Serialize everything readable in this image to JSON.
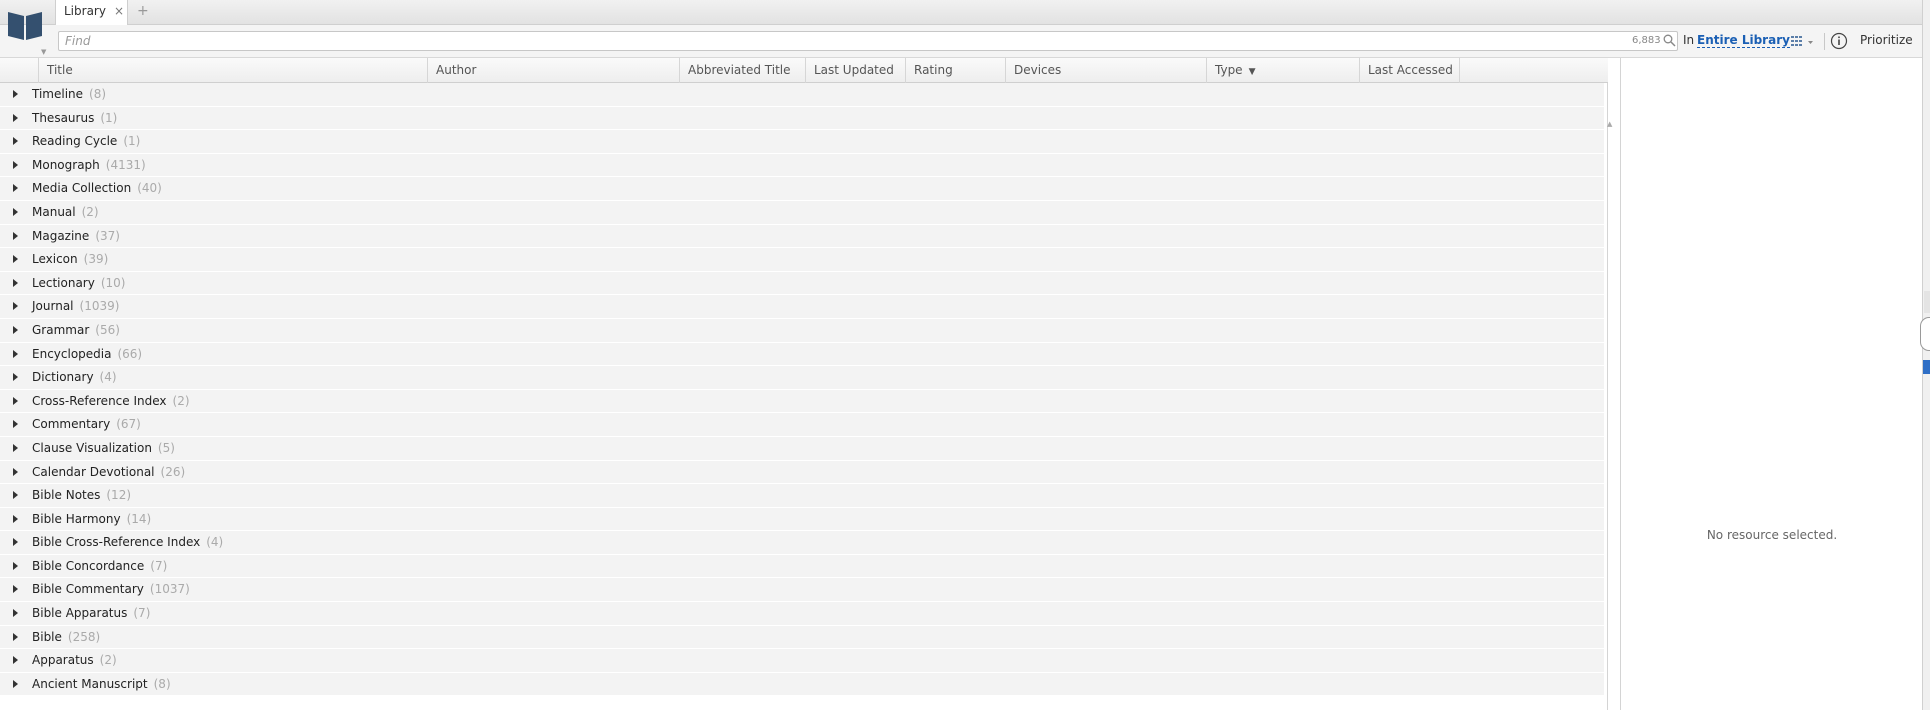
{
  "tab": {
    "label": "Library",
    "close": "×",
    "new_tab": "+"
  },
  "search": {
    "placeholder": "Find",
    "result_count": "6,883",
    "scope_prefix": "In",
    "scope_value": "Entire Library"
  },
  "toolbar": {
    "prioritize_label": "Prioritize"
  },
  "columns": [
    {
      "label": "Title"
    },
    {
      "label": "Author"
    },
    {
      "label": "Abbreviated Title"
    },
    {
      "label": "Last Updated"
    },
    {
      "label": "Rating"
    },
    {
      "label": "Devices"
    },
    {
      "label": "Type"
    },
    {
      "label": "Last Accessed"
    }
  ],
  "groups": [
    {
      "label": "Timeline",
      "count": "(8)"
    },
    {
      "label": "Thesaurus",
      "count": "(1)"
    },
    {
      "label": "Reading Cycle",
      "count": "(1)"
    },
    {
      "label": "Monograph",
      "count": "(4131)"
    },
    {
      "label": "Media Collection",
      "count": "(40)"
    },
    {
      "label": "Manual",
      "count": "(2)"
    },
    {
      "label": "Magazine",
      "count": "(37)"
    },
    {
      "label": "Lexicon",
      "count": "(39)"
    },
    {
      "label": "Lectionary",
      "count": "(10)"
    },
    {
      "label": "Journal",
      "count": "(1039)"
    },
    {
      "label": "Grammar",
      "count": "(56)"
    },
    {
      "label": "Encyclopedia",
      "count": "(66)"
    },
    {
      "label": "Dictionary",
      "count": "(4)"
    },
    {
      "label": "Cross-Reference Index",
      "count": "(2)"
    },
    {
      "label": "Commentary",
      "count": "(67)"
    },
    {
      "label": "Clause Visualization",
      "count": "(5)"
    },
    {
      "label": "Calendar Devotional",
      "count": "(26)"
    },
    {
      "label": "Bible Notes",
      "count": "(12)"
    },
    {
      "label": "Bible Harmony",
      "count": "(14)"
    },
    {
      "label": "Bible Cross-Reference Index",
      "count": "(4)"
    },
    {
      "label": "Bible Concordance",
      "count": "(7)"
    },
    {
      "label": "Bible Commentary",
      "count": "(1037)"
    },
    {
      "label": "Bible Apparatus",
      "count": "(7)"
    },
    {
      "label": "Bible",
      "count": "(258)"
    },
    {
      "label": "Apparatus",
      "count": "(2)"
    },
    {
      "label": "Ancient Manuscript",
      "count": "(8)"
    }
  ],
  "detail": {
    "empty_message": "No resource selected."
  },
  "colors": {
    "accent": "#1a5fb4",
    "row_bg": "#f3f3f3",
    "count_text": "#aaaaaa"
  }
}
